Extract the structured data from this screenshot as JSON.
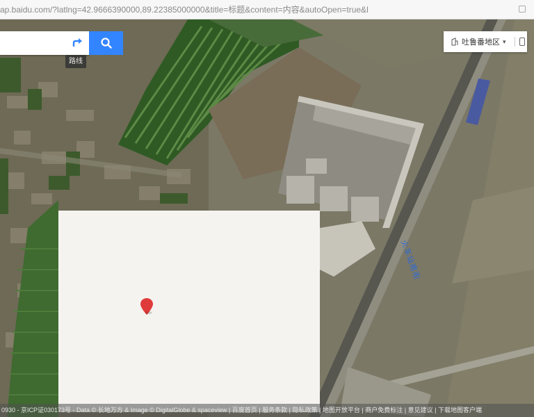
{
  "browser": {
    "url": "ap.baidu.com/?latlng=42.9666390000,89.22385000000&title=标题&content=内容&autoOpen=true&l"
  },
  "map": {
    "search": {
      "route_tooltip": "路线"
    },
    "city_selector": {
      "label": "吐鲁番地区"
    },
    "road_label": "火车站南街",
    "footer": {
      "copyright": "0930 - 京ICP证030173号 - Data © 长地万方 & Image © DigitalGlobe & spaceview",
      "links": [
        "百度首页",
        "服务条款",
        "隐私政策",
        "地图开放平台",
        "商户免费标注",
        "意见建议",
        "下载地图客户端"
      ]
    },
    "marker_color": "#e03b3b",
    "accent_color": "#3385ff"
  }
}
